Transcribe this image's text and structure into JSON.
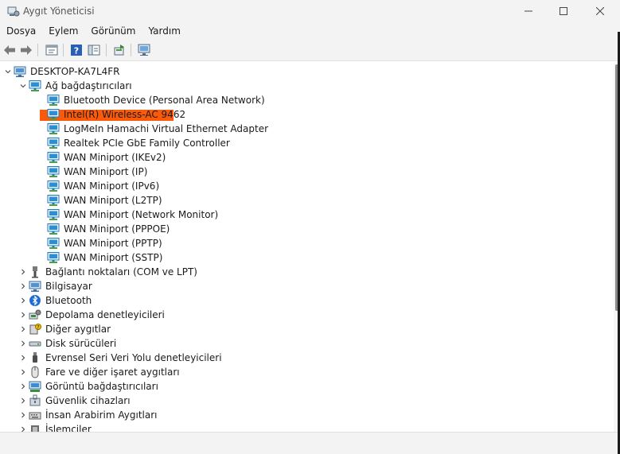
{
  "window": {
    "title": "Aygıt Yöneticisi",
    "controls": [
      "minimize-icon",
      "maximize-icon",
      "close-icon"
    ]
  },
  "menu": {
    "items": [
      "Dosya",
      "Eylem",
      "Görünüm",
      "Yardım"
    ]
  },
  "toolbar": {
    "buttons": [
      "back-icon",
      "forward-icon",
      "properties-icon",
      "help-icon",
      "console-tree-icon",
      "update-driver-icon",
      "scan-hardware-icon"
    ]
  },
  "colors": {
    "highlight": "#fb5a0b",
    "network_icon": "#2b8fd6",
    "chrome": "#f3f3f3"
  },
  "tree": {
    "root": "DESKTOP-KA7L4FR",
    "network_category": "Ağ bağdaştırıcıları",
    "network_adapters": [
      "Bluetooth Device (Personal Area Network)",
      "Intel(R) Wireless-AC 9462",
      "LogMeIn Hamachi Virtual Ethernet Adapter",
      "Realtek PCIe GbE Family Controller",
      "WAN Miniport (IKEv2)",
      "WAN Miniport (IP)",
      "WAN Miniport (IPv6)",
      "WAN Miniport (L2TP)",
      "WAN Miniport (Network Monitor)",
      "WAN Miniport (PPPOE)",
      "WAN Miniport (PPTP)",
      "WAN Miniport (SSTP)"
    ],
    "categories": [
      {
        "label": "Bağlantı noktaları (COM ve LPT)",
        "icon": "port-icon"
      },
      {
        "label": "Bilgisayar",
        "icon": "computer-icon"
      },
      {
        "label": "Bluetooth",
        "icon": "bluetooth-icon"
      },
      {
        "label": "Depolama denetleyicileri",
        "icon": "storage-controller-icon"
      },
      {
        "label": "Diğer aygıtlar",
        "icon": "other-devices-icon"
      },
      {
        "label": "Disk sürücüleri",
        "icon": "disk-drive-icon"
      },
      {
        "label": "Evrensel Seri Veri Yolu denetleyicileri",
        "icon": "usb-icon"
      },
      {
        "label": "Fare ve diğer işaret aygıtları",
        "icon": "mouse-icon"
      },
      {
        "label": "Görüntü bağdaştırıcıları",
        "icon": "display-adapter-icon"
      },
      {
        "label": "Güvenlik cihazları",
        "icon": "security-device-icon"
      },
      {
        "label": "İnsan Arabirim Aygıtları",
        "icon": "hid-icon"
      },
      {
        "label": "İşlemciler",
        "icon": "processor-icon"
      }
    ]
  }
}
